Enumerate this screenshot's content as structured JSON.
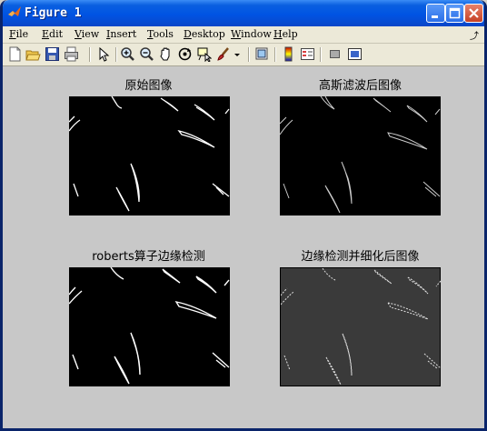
{
  "window": {
    "title": "Figure 1"
  },
  "menu": {
    "items": [
      {
        "key": "F",
        "rest": "ile"
      },
      {
        "key": "E",
        "rest": "dit"
      },
      {
        "key": "V",
        "rest": "iew"
      },
      {
        "key": "I",
        "rest": "nsert"
      },
      {
        "key": "T",
        "rest": "ools"
      },
      {
        "key": "D",
        "rest": "esktop"
      },
      {
        "key": "W",
        "rest": "indow"
      },
      {
        "key": "H",
        "rest": "elp"
      }
    ]
  },
  "toolbar": {
    "icons": [
      "new-figure-icon",
      "open-file-icon",
      "save-icon",
      "print-icon",
      "pointer-icon",
      "zoom-in-icon",
      "zoom-out-icon",
      "pan-icon",
      "rotate-3d-icon",
      "data-cursor-icon",
      "brush-icon",
      "link-plot-icon",
      "colorbar-icon",
      "legend-icon",
      "hide-plot-tools-icon",
      "show-plot-tools-icon"
    ]
  },
  "panels": {
    "original": {
      "title": "原始图像"
    },
    "gaussian": {
      "title": "高斯滤波后图像"
    },
    "roberts": {
      "title": "roberts算子边缘检测"
    },
    "thinned": {
      "title": "边缘检测并细化后图像"
    }
  }
}
